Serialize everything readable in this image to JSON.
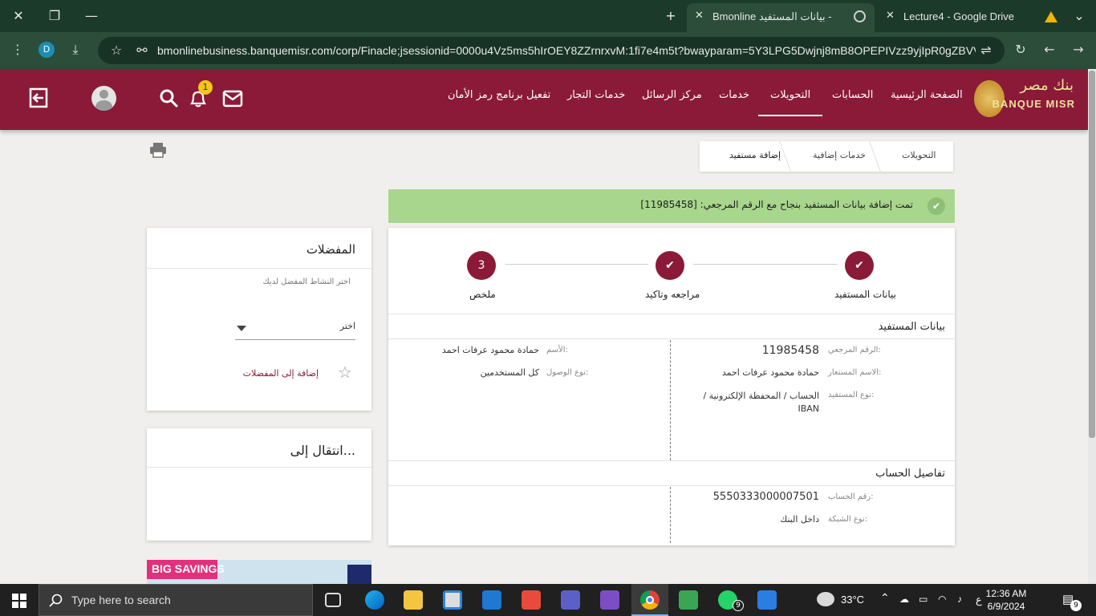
{
  "browser": {
    "tabs": [
      {
        "title": "Bmonline بيانات المستفيد -",
        "active": true
      },
      {
        "title": "Lecture4 - Google Drive",
        "active": false
      }
    ],
    "url": "bmonlinebusiness.banquemisr.com/corp/Finacle;jsessionid=0000u4Vz5ms5hIrOEY8ZZrnrxvM:1fi7e4m5t?bwayparam=5Y3LPG5Dwjnj8mB8OPEPIVzz9yjIpR0gZBVVn...",
    "profile_initial": "D"
  },
  "header": {
    "logo_ar": "بنك مصر",
    "logo_en": "BANQUE MISR",
    "nav": [
      {
        "label": "الصفحة الرئيسية"
      },
      {
        "label": "الحسابات"
      },
      {
        "label": "التحويلات",
        "active": true
      },
      {
        "label": "خدمات"
      },
      {
        "label": "مركز الرسائل"
      },
      {
        "label": "خدمات التجار"
      },
      {
        "label": "تفعيل برنامج رمز الأمان"
      }
    ],
    "notification_count": "1"
  },
  "breadcrumb": [
    "التحويلات",
    "خدمات إضافية",
    "إضافة مستفيد"
  ],
  "success": {
    "message": "تمت إضافة بيانات المستفيد بنجاح مع الرقم المرجعي: [11985458]"
  },
  "steps": [
    {
      "label": "بيانات المستفيد",
      "status": "done"
    },
    {
      "label": "مراجعه وتاكيد",
      "status": "done"
    },
    {
      "label": "ملخص",
      "number": "3",
      "status": "current"
    }
  ],
  "beneficiary": {
    "title": "بيانات المستفيد",
    "ref_label": "الرقم المرجعي:",
    "ref_value": "11985458",
    "alias_label": "الاسم المستعار:",
    "alias_value": "حمادة محمود عرفات احمد",
    "type_label": "نوع المستفيد:",
    "type_value": "الحساب / المحفظة الإلكترونية / IBAN",
    "name_label": "الأسم:",
    "name_value": "حمادة محمود عرفات احمد",
    "access_label": "نوع الوصول:",
    "access_value": "كل المستخدمين"
  },
  "account": {
    "title": "تفاصيل الحساب",
    "number_label": "رقم الحساب:",
    "number_value": "5550333000007501",
    "network_label": "نوع الشبكة:",
    "network_value": "داخل البنك"
  },
  "favorites": {
    "title": "المفضلات",
    "subtitle": "اختر النشاط المفضل لديك",
    "select_value": "اختر",
    "add_link": "إضافة إلى المفضلات"
  },
  "navigate": {
    "title": "انتقال إلى..."
  },
  "banner": {
    "text": "BIG SAVINGS"
  },
  "taskbar": {
    "search_placeholder": "Type here to search",
    "temperature": "33°C",
    "time": "12:36 AM",
    "date": "6/9/2024",
    "lang": "ع",
    "notif_count": "9",
    "whatsapp_badge": "9"
  },
  "colors": {
    "brand": "#8a1a37",
    "success_bg": "#a8d68c",
    "chrome_dark": "#1c3a2a"
  }
}
